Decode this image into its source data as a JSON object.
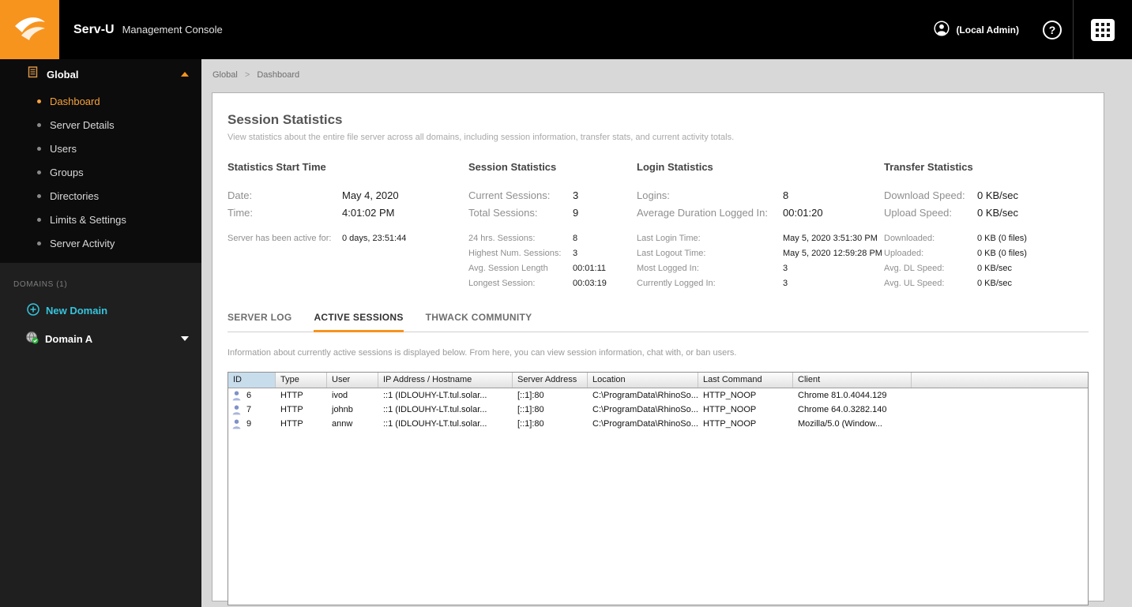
{
  "topbar": {
    "app_name": "Serv-U",
    "app_subtitle": "Management Console",
    "user_label": "(Local Admin)",
    "help_label": "?"
  },
  "breadcrumb": {
    "root": "Global",
    "separator": ">",
    "current": "Dashboard"
  },
  "sidebar": {
    "global_label": "Global",
    "items": [
      {
        "label": "Dashboard",
        "active": true
      },
      {
        "label": "Server Details"
      },
      {
        "label": "Users"
      },
      {
        "label": "Groups"
      },
      {
        "label": "Directories"
      },
      {
        "label": "Limits & Settings"
      },
      {
        "label": "Server Activity"
      }
    ],
    "domains_label": "DOMAINS (1)",
    "new_domain_label": "New Domain",
    "domain_label": "Domain A"
  },
  "panel": {
    "title": "Session Statistics",
    "description": "View statistics about the entire file server across all domains, including session information, transfer stats, and current activity totals."
  },
  "stats": {
    "columns": [
      {
        "title": "Statistics Start Time",
        "primary": [
          {
            "label": "Date:",
            "value": "May 4, 2020"
          },
          {
            "label": "Time:",
            "value": "4:01:02 PM"
          }
        ],
        "secondary": [
          {
            "label": "Server has been active for:",
            "value": "0 days, 23:51:44"
          }
        ]
      },
      {
        "title": "Session Statistics",
        "primary": [
          {
            "label": "Current Sessions:",
            "value": "3"
          },
          {
            "label": "Total Sessions:",
            "value": "9"
          }
        ],
        "secondary": [
          {
            "label": "24 hrs. Sessions:",
            "value": "8"
          },
          {
            "label": "Highest Num. Sessions:",
            "value": "3"
          },
          {
            "label": "Avg. Session Length",
            "value": "00:01:11"
          },
          {
            "label": "Longest Session:",
            "value": "00:03:19"
          }
        ]
      },
      {
        "title": "Login Statistics",
        "primary": [
          {
            "label": "Logins:",
            "value": "8"
          },
          {
            "label": "Average Duration Logged In:",
            "value": "00:01:20"
          }
        ],
        "secondary": [
          {
            "label": "Last Login Time:",
            "value": "May 5, 2020 3:51:30 PM"
          },
          {
            "label": "Last Logout Time:",
            "value": "May 5, 2020 12:59:28 PM"
          },
          {
            "label": "Most Logged In:",
            "value": "3"
          },
          {
            "label": "Currently Logged In:",
            "value": "3"
          }
        ]
      },
      {
        "title": "Transfer Statistics",
        "primary": [
          {
            "label": "Download Speed:",
            "value": "0 KB/sec"
          },
          {
            "label": "Upload Speed:",
            "value": "0 KB/sec"
          }
        ],
        "secondary": [
          {
            "label": "Downloaded:",
            "value": "0 KB (0 files)"
          },
          {
            "label": "Uploaded:",
            "value": "0 KB (0 files)"
          },
          {
            "label": "Avg. DL Speed:",
            "value": "0 KB/sec"
          },
          {
            "label": "Avg. UL Speed:",
            "value": "0 KB/sec"
          }
        ]
      }
    ]
  },
  "tabs": {
    "items": [
      {
        "label": "SERVER LOG"
      },
      {
        "label": "ACTIVE SESSIONS",
        "active": true
      },
      {
        "label": "THWACK COMMUNITY"
      }
    ],
    "description": "Information about currently active sessions is displayed below. From here, you can view session information, chat with, or ban users."
  },
  "sessions_table": {
    "columns": [
      "ID",
      "Type",
      "User",
      "IP Address / Hostname",
      "Server Address",
      "Location",
      "Last Command",
      "Client"
    ],
    "rows": [
      {
        "id": "6",
        "type": "HTTP",
        "user": "ivod",
        "ip": "::1 (IDLOUHY-LT.tul.solar...",
        "server_address": "[::1]:80",
        "location": "C:\\ProgramData\\RhinoSo...",
        "last_command": "HTTP_NOOP",
        "client": "Chrome 81.0.4044.129"
      },
      {
        "id": "7",
        "type": "HTTP",
        "user": "johnb",
        "ip": "::1 (IDLOUHY-LT.tul.solar...",
        "server_address": "[::1]:80",
        "location": "C:\\ProgramData\\RhinoSo...",
        "last_command": "HTTP_NOOP",
        "client": "Chrome 64.0.3282.140"
      },
      {
        "id": "9",
        "type": "HTTP",
        "user": "annw",
        "ip": "::1 (IDLOUHY-LT.tul.solar...",
        "server_address": "[::1]:80",
        "location": "C:\\ProgramData\\RhinoSo...",
        "last_command": "HTTP_NOOP",
        "client": "Mozilla/5.0 (Window..."
      }
    ]
  },
  "colors": {
    "accent_orange": "#f7941e",
    "accent_cyan": "#35c4dc",
    "sorted_header_blue": "#c8ddec"
  }
}
